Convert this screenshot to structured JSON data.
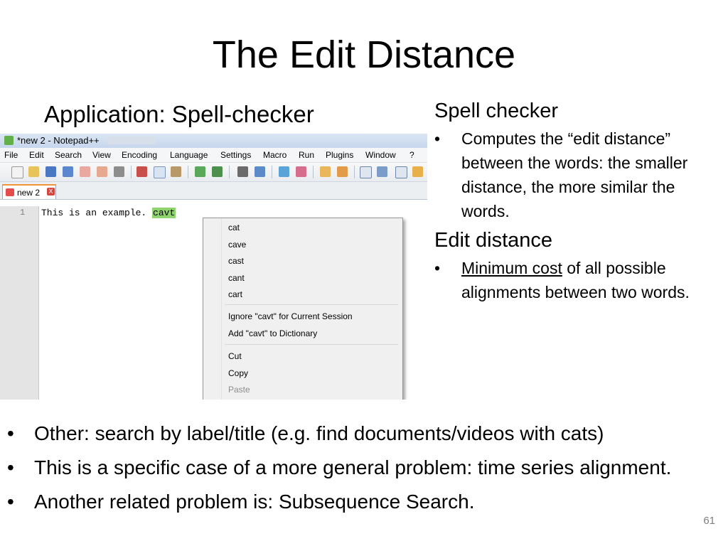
{
  "slide": {
    "title": "The Edit Distance",
    "subhead": "Application: Spell-checker",
    "page_number": "61"
  },
  "right_panel": {
    "heading1": "Spell checker",
    "bullet1": "Computes the “edit distance” between the words: the smaller distance, the more similar the words.",
    "heading2": "Edit distance",
    "bullet2_underlined": "Minimum cost",
    "bullet2_rest": " of all possible alignments between two words.",
    "bullet_glyph": "•"
  },
  "bottom_bullets": [
    "Other: search by label/title (e.g. find documents/videos with cats)",
    "This is a specific case of a more general problem: time series alignment.",
    "Another related problem is: Subsequence Search."
  ],
  "notepad": {
    "window_title": "*new 2 - Notepad++",
    "menu": [
      "File",
      "Edit",
      "Search",
      "View",
      "Encoding",
      "Language",
      "Settings",
      "Macro",
      "Run",
      "Plugins",
      "Window",
      "?"
    ],
    "tab_label": "new 2",
    "tab_close": "X",
    "line_number": "1",
    "line_text": "This is an example. ",
    "misspelled_word": "cavt",
    "context_menu": {
      "suggestions": [
        "cat",
        "cave",
        "cast",
        "cant",
        "cart"
      ],
      "ignore": "Ignore \"cavt\" for Current Session",
      "add": "Add \"cavt\" to Dictionary",
      "cut": "Cut",
      "copy": "Copy",
      "paste": "Paste"
    }
  }
}
